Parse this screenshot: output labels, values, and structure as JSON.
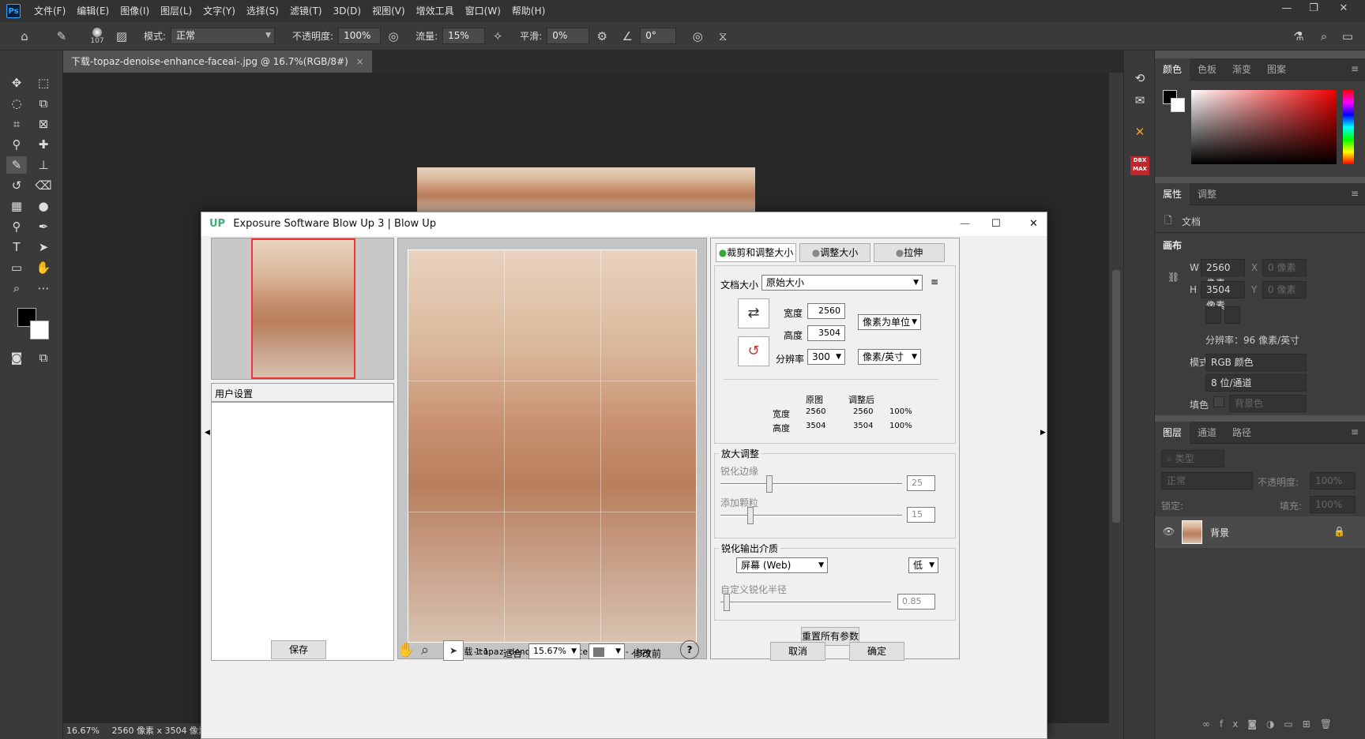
{
  "app": {
    "logo": "Ps"
  },
  "menu": [
    "文件(F)",
    "编辑(E)",
    "图像(I)",
    "图层(L)",
    "文字(Y)",
    "选择(S)",
    "滤镜(T)",
    "3D(D)",
    "视图(V)",
    "增效工具",
    "窗口(W)",
    "帮助(H)"
  ],
  "options": {
    "brush_size": "107",
    "mode_label": "模式:",
    "mode_value": "正常",
    "opacity_label": "不透明度:",
    "opacity_value": "100%",
    "flow_label": "流量:",
    "flow_value": "15%",
    "smooth_label": "平滑:",
    "smooth_value": "0%",
    "angle_value": "0°"
  },
  "doc_tab": {
    "title": "下载-topaz-denoise-enhance-faceai-.jpg @ 16.7%(RGB/8#)",
    "close": "×"
  },
  "status": {
    "zoom": "16.67%",
    "size": "2560 像素 x 3504 像素"
  },
  "color_panel": {
    "tabs": [
      "颜色",
      "色板",
      "渐变",
      "图案"
    ]
  },
  "properties": {
    "tabs": [
      "属性",
      "调整"
    ],
    "doc_label": "文档",
    "canvas_label": "画布",
    "w_label": "W",
    "w_value": "2560 像素",
    "h_label": "H",
    "h_value": "3504 像素",
    "x_label": "X",
    "x_value": "0 像素",
    "y_label": "Y",
    "y_value": "0 像素",
    "resolution": "分辨率：96 像素/英寸",
    "mode_label": "模式",
    "mode_value": "RGB 颜色",
    "depth_value": "8 位/通道",
    "fill_label": "填色",
    "fill_value": "背景色"
  },
  "layers": {
    "tabs": [
      "图层",
      "通道",
      "路径"
    ],
    "kind_placeholder": "类型",
    "blend": "正常",
    "opacity_label": "不透明度:",
    "opacity_value": "100%",
    "lock_label": "锁定:",
    "fill_label": "填充:",
    "fill_value": "100%",
    "layer_name": "背景"
  },
  "dialog": {
    "title": "Exposure Software Blow Up 3 | Blow Up",
    "user_settings": "用户设置",
    "filename": "下载-topaz-denoise-enhance-faceai-.jpg",
    "tabs": [
      "裁剪和调整大小",
      "调整大小",
      "拉伸"
    ],
    "doc_size_label": "文档大小",
    "doc_size_value": "原始大小",
    "width_label": "宽度",
    "width_value": "2560",
    "height_label": "高度",
    "height_value": "3504",
    "res_label": "分辨率",
    "res_value": "300",
    "unit_px": "像素为单位",
    "unit_ppi": "像素/英寸",
    "col_orig": "原图",
    "col_after": "调整后",
    "row_w": "宽度",
    "row_h": "高度",
    "w_orig": "2560",
    "w_after": "2560",
    "w_pct": "100%",
    "h_orig": "3504",
    "h_after": "3504",
    "h_pct": "100%",
    "enlarge_title": "放大调整",
    "sharpen_edges": "锐化边缘",
    "sharpen_edges_value": "25",
    "add_grain": "添加颗粒",
    "add_grain_value": "15",
    "output_title": "锐化输出介质",
    "media": "屏幕 (Web)",
    "media_level": "低",
    "radius_label": "自定义锐化半径",
    "radius_value": "0.85",
    "reset": "重置所有参数",
    "save": "保存",
    "ratio": "1:1",
    "fit": "适合",
    "zoom": "15.67%",
    "before": "修改前",
    "cancel": "取消",
    "ok": "确定"
  }
}
